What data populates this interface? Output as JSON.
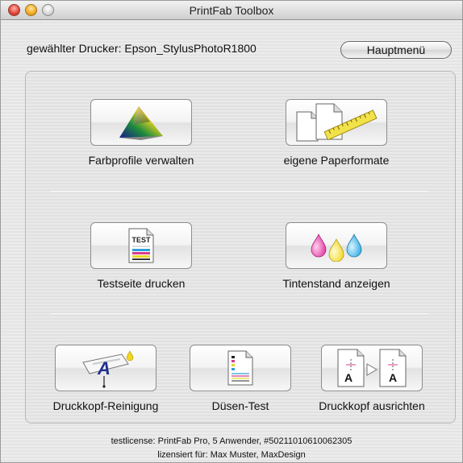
{
  "window": {
    "title": "PrintFab Toolbox"
  },
  "header": {
    "printer_label": "gewählter Drucker: Epson_StylusPhotoR1800",
    "main_menu_label": "Hauptmenü"
  },
  "tools": {
    "color_profiles": "Farbprofile verwalten",
    "paper_formats": "eigene Paperformate",
    "print_test_page": "Testseite drucken",
    "ink_level": "Tintenstand anzeigen",
    "head_cleaning": "Druckkopf-Reinigung",
    "nozzle_test": "Düsen-Test",
    "head_alignment": "Druckkopf ausrichten"
  },
  "icons": {
    "color_profiles": "color-gamut-icon",
    "paper_formats": "paper-ruler-icon",
    "print_test_page": "test-page-icon",
    "ink_level": "ink-drops-icon",
    "head_cleaning": "print-head-cleaning-icon",
    "nozzle_test": "nozzle-pattern-icon",
    "head_alignment": "head-alignment-icon"
  },
  "test_page_icon_text": "TEST",
  "alignment_icon_text": "A",
  "footer": {
    "license": "testlicense: PrintFab Pro, 5 Anwender, #50211010610062305",
    "licensed_to": "lizensiert für: Max Muster, MaxDesign"
  }
}
